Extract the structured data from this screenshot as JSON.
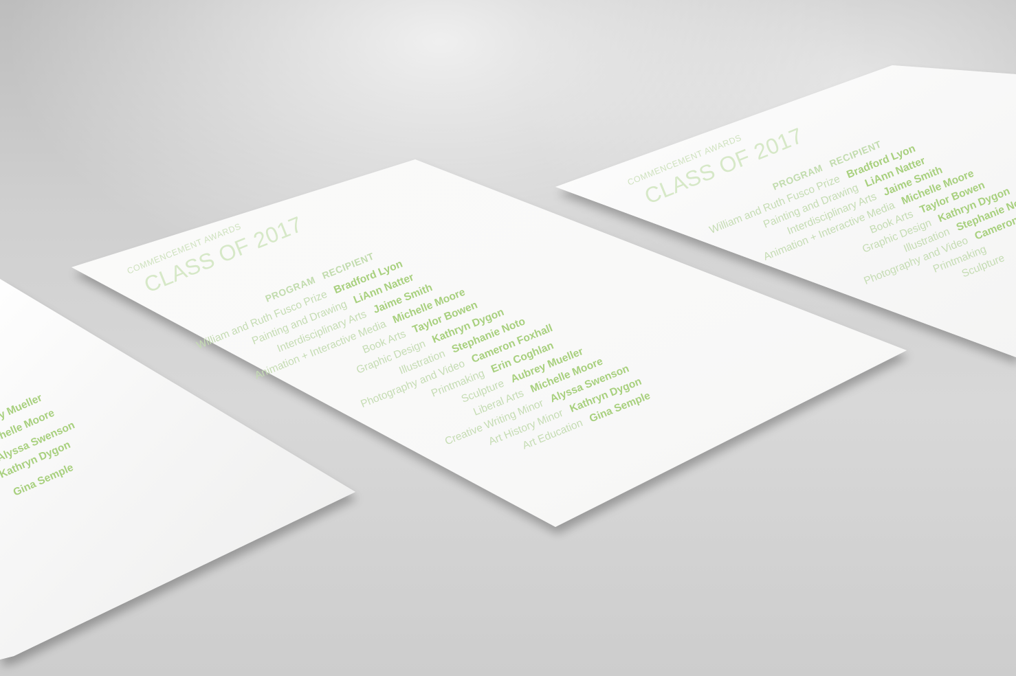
{
  "card": {
    "eyebrow": "COMMENCEMENT AWARDS",
    "title": "CLASS OF 2017",
    "col_program": "PROGRAM",
    "col_recipient": "RECIPIENT",
    "rows": [
      {
        "program": "William and Ruth Fusco Prize",
        "recipient": "Bradford Lyon"
      },
      {
        "program": "Painting and Drawing",
        "recipient": "LiAnn Natter"
      },
      {
        "program": "Interdisciplinary Arts",
        "recipient": "Jaime Smith"
      },
      {
        "program": "Animation + Interactive Media",
        "recipient": "Michelle Moore"
      },
      {
        "program": "Book Arts",
        "recipient": "Taylor Bowen"
      },
      {
        "program": "Graphic Design",
        "recipient": "Kathryn Dygon"
      },
      {
        "program": "Illustration",
        "recipient": "Stephanie Noto"
      },
      {
        "program": "Photography and Video",
        "recipient": "Cameron Foxhall"
      },
      {
        "program": "Printmaking",
        "recipient": "Erin Coghlan"
      },
      {
        "program": "Sculpture",
        "recipient": "Aubrey Mueller"
      },
      {
        "program": "Liberal Arts",
        "recipient": "Michelle Moore"
      },
      {
        "program": "Creative Writing Minor",
        "recipient": "Alyssa Swenson"
      },
      {
        "program": "Art History Minor",
        "recipient": "Kathryn Dygon"
      },
      {
        "program": "Art Education",
        "recipient": "Gina Semple"
      }
    ]
  },
  "left_card_visible": {
    "recipients": [
      "Aubrey Mueller",
      "Michelle Moore",
      "Alyssa Swenson",
      "Kathryn Dygon",
      "Gina Semple"
    ]
  },
  "right_card_visible": {
    "programs": [
      "William and Ruth Fusco Prize",
      "Painting and Drawing",
      "Interdisciplinary Arts",
      "Animation + Interactive Media",
      "Book Arts",
      "Graphic Design",
      "Illustration",
      "Photography and Video",
      "Printmaking",
      "Sculpture"
    ],
    "recipients": [
      "Bradford Lyon",
      "LiAnn Natter",
      "Jaime Smith",
      "Michelle Moore",
      "Taylor Bowen",
      "Kathryn Dygon",
      "Stephanie Noto",
      "Cameron Foxhall"
    ]
  },
  "colors": {
    "accent_green": "#a8d07e",
    "label_green": "#c5dcb3",
    "paper": "#f7f7f6",
    "backdrop": "#cfcfcf"
  }
}
